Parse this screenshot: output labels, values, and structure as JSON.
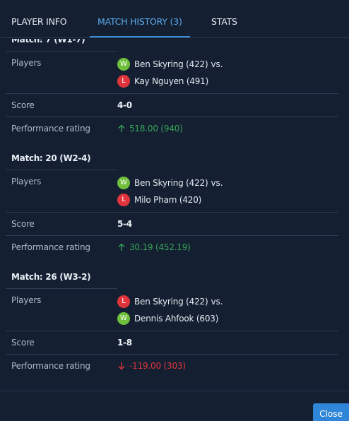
{
  "tabs": [
    {
      "label": "PLAYER INFO",
      "active": false
    },
    {
      "label": "MATCH HISTORY (3)",
      "active": true
    },
    {
      "label": "STATS",
      "active": false
    }
  ],
  "labels": {
    "players": "Players",
    "score": "Score",
    "performance": "Performance rating",
    "vs": "vs."
  },
  "matches": [
    {
      "title": "Match: 7 (W1-7)",
      "players": [
        {
          "result": "W",
          "name": "Ben Skyring (422)"
        },
        {
          "result": "L",
          "name": "Kay Nguyen (491)"
        }
      ],
      "score": "4-0",
      "performance": {
        "direction": "up",
        "text": "518.00 (940)"
      }
    },
    {
      "title": "Match: 20 (W2-4)",
      "players": [
        {
          "result": "W",
          "name": "Ben Skyring (422)"
        },
        {
          "result": "L",
          "name": "Milo Pham (420)"
        }
      ],
      "score": "5-4",
      "performance": {
        "direction": "up",
        "text": "30.19 (452.19)"
      }
    },
    {
      "title": "Match: 26 (W3-2)",
      "players": [
        {
          "result": "L",
          "name": "Ben Skyring (422)"
        },
        {
          "result": "W",
          "name": "Dennis Ahfook (603)"
        }
      ],
      "score": "1-8",
      "performance": {
        "direction": "down",
        "text": "-119.00 (303)"
      }
    }
  ],
  "colors": {
    "accent": "#3d8fdc",
    "win": "#6fbf3c",
    "loss": "#e0343c",
    "rating_up": "#36a457",
    "rating_down": "#e0343c"
  },
  "footer": {
    "close_label": "Close"
  }
}
